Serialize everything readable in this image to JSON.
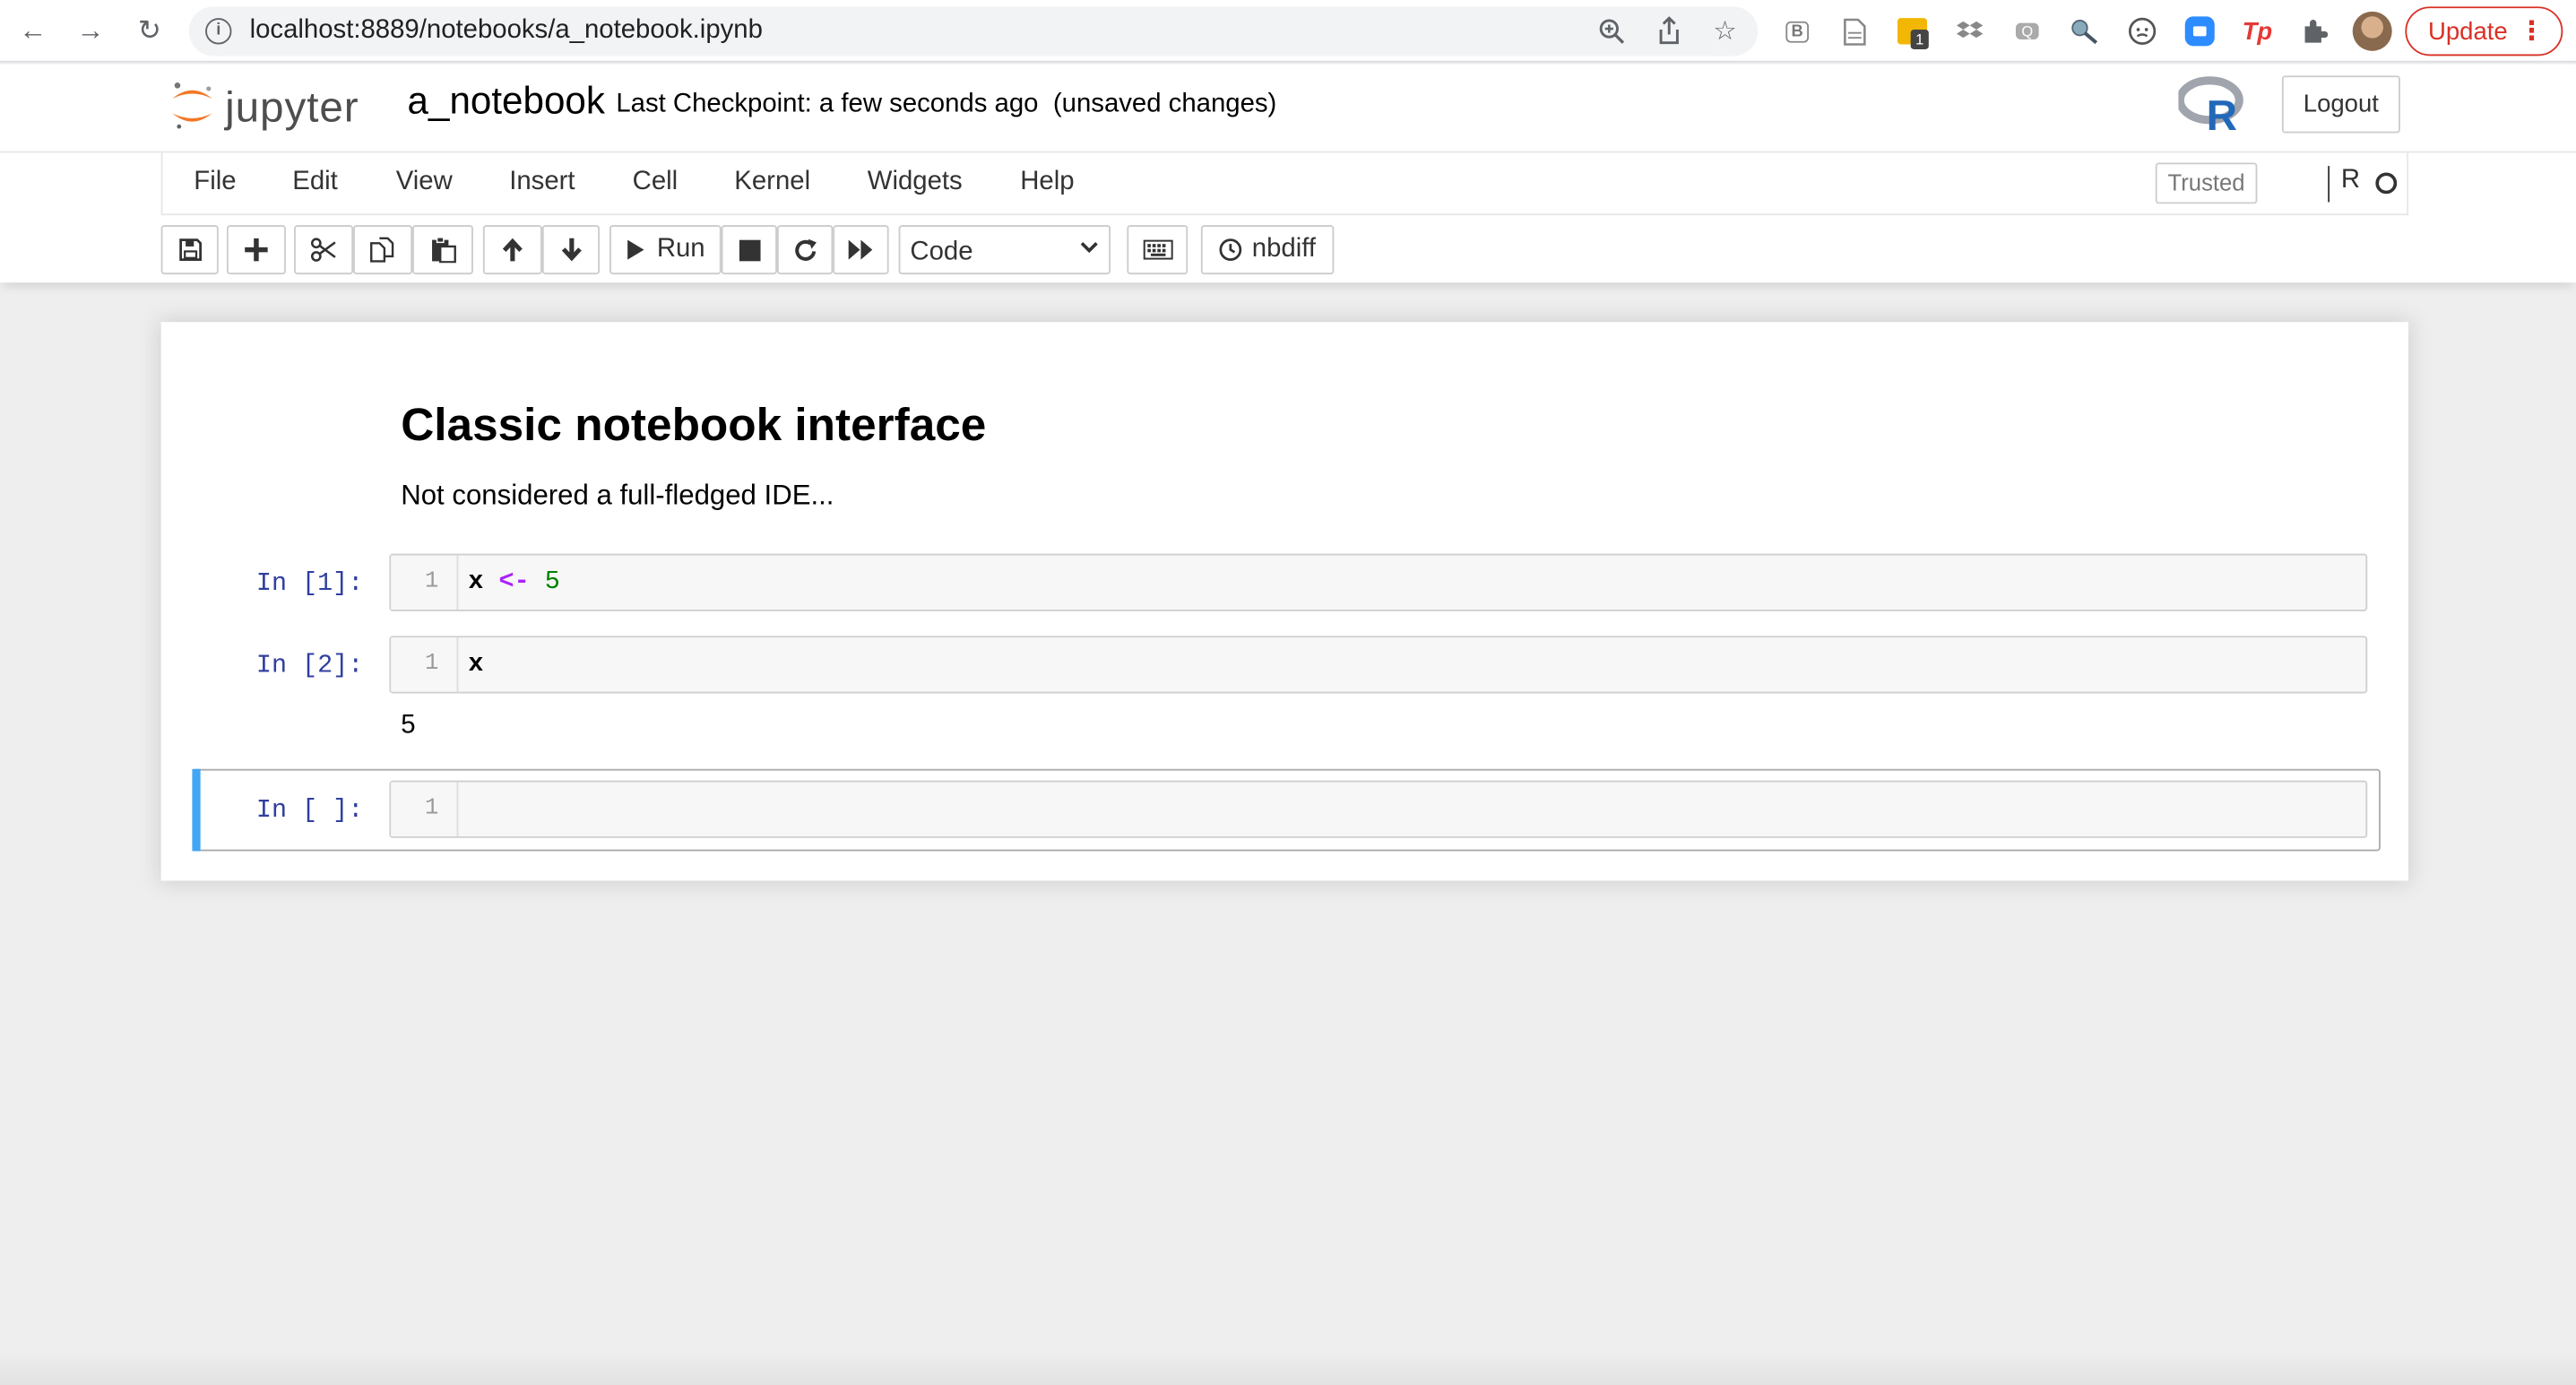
{
  "browser": {
    "url": "localhost:8889/notebooks/a_notebook.ipynb",
    "extension_badge": "1",
    "update_label": "Update",
    "menu_glyph": "⋮"
  },
  "header": {
    "logo_text": "jupyter",
    "notebook_name": "a_notebook",
    "checkpoint": "Last Checkpoint: a few seconds ago",
    "autosave": "(unsaved changes)",
    "kernel_logo_letter": "R",
    "logout_label": "Logout"
  },
  "menubar": {
    "items": [
      "File",
      "Edit",
      "View",
      "Insert",
      "Cell",
      "Kernel",
      "Widgets",
      "Help"
    ],
    "trusted_label": "Trusted",
    "kernel_name": "R"
  },
  "toolbar": {
    "run_label": "Run",
    "cell_type": "Code",
    "nbdiff_label": "nbdiff"
  },
  "notebook": {
    "markdown": {
      "title": "Classic notebook interface",
      "text": "Not considered a full-fledged IDE..."
    },
    "cells": [
      {
        "prompt": "In [1]:",
        "line_number": "1",
        "tokens": [
          "x",
          "<-",
          "5"
        ]
      },
      {
        "prompt": "In [2]:",
        "line_number": "1",
        "tokens": [
          "x"
        ],
        "output": "5"
      },
      {
        "prompt": "In [ ]:",
        "line_number": "1",
        "tokens": []
      }
    ]
  },
  "colors": {
    "selected_bar": "#42a5f5",
    "prompt": "#303f9f",
    "operator": "#aa22ff",
    "number": "#008000",
    "jupyter_orange": "#f37726",
    "update_red": "#d93025"
  }
}
